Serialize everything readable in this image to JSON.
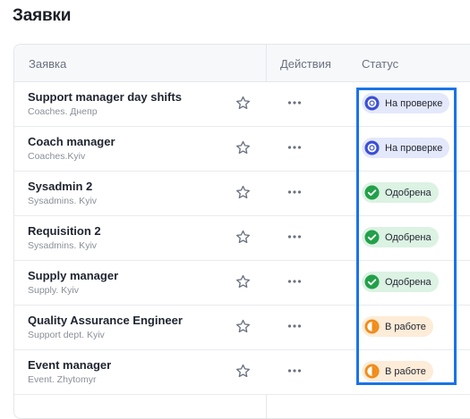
{
  "page": {
    "title": "Заявки"
  },
  "table": {
    "headers": {
      "request": "Заявка",
      "actions": "Действия",
      "status": "Статус"
    },
    "rows": [
      {
        "title": "Support manager day shifts",
        "subtitle": "Coaches. Днепр",
        "status": "На проверке",
        "status_type": "review"
      },
      {
        "title": "Coach manager",
        "subtitle": "Coaches.Kyiv",
        "status": "На проверке",
        "status_type": "review"
      },
      {
        "title": "Sysadmin 2",
        "subtitle": "Sysadmins. Kyiv",
        "status": "Одобрена",
        "status_type": "approved"
      },
      {
        "title": "Requisition 2",
        "subtitle": "Sysadmins. Kyiv",
        "status": "Одобрена",
        "status_type": "approved"
      },
      {
        "title": "Supply manager",
        "subtitle": "Supply. Kyiv",
        "status": "Одобрена",
        "status_type": "approved"
      },
      {
        "title": "Quality Assurance Engineer",
        "subtitle": "Support dept. Kyiv",
        "status": "В работе",
        "status_type": "inwork"
      },
      {
        "title": "Event manager",
        "subtitle": "Event. Zhytomyr",
        "status": "В работе",
        "status_type": "inwork"
      }
    ]
  },
  "icons": {
    "favorite": "star-outline-icon",
    "actions": "more-horizontal-icon",
    "review": "review-status-icon",
    "approved": "check-circle-icon",
    "inwork": "in-progress-icon"
  },
  "colors": {
    "review": "#3b4fd6",
    "approved": "#22a04a",
    "inwork": "#f08c1a",
    "highlight": "#1a73e8"
  }
}
